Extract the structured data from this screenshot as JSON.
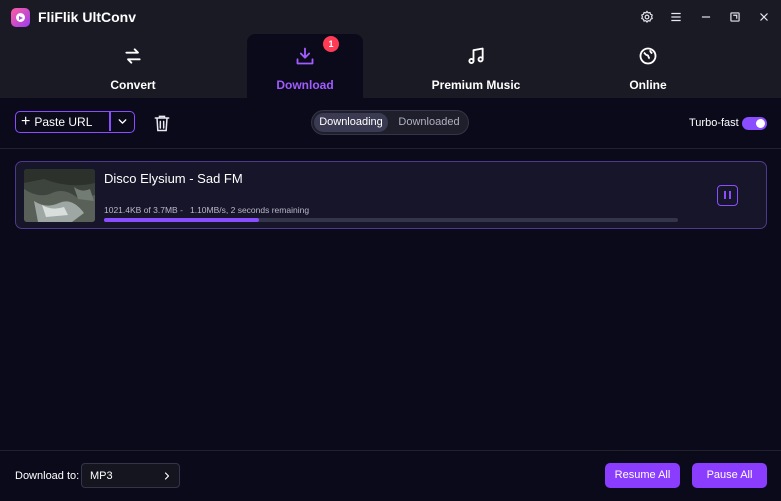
{
  "app": {
    "title": "FliFlik UltConv"
  },
  "nav": {
    "tabs": [
      {
        "label": "Convert",
        "icon": "arrows-swap-icon"
      },
      {
        "label": "Download",
        "icon": "download-icon",
        "badge": "1",
        "active": true
      },
      {
        "label": "Premium Music",
        "icon": "music-note-icon"
      },
      {
        "label": "Online",
        "icon": "globe-icon"
      }
    ]
  },
  "toolbar": {
    "paste_url": "Paste URL",
    "segments": {
      "downloading": "Downloading",
      "downloaded": "Downloaded"
    },
    "turbo": {
      "label": "Turbo-fast",
      "enabled": true
    }
  },
  "downloads": [
    {
      "title": "Disco Elysium - Sad FM",
      "status": "1021.4KB of 3.7MB -   1.10MB/s, 2 seconds remaining",
      "progress": 0.27
    }
  ],
  "footer": {
    "download_to_label": "Download to:",
    "format": "MP3",
    "resume_all": "Resume All",
    "pause_all": "Pause All"
  },
  "colors": {
    "accent": "#8a4dff",
    "badge": "#ff3b55",
    "background": "#0b0a1a"
  }
}
